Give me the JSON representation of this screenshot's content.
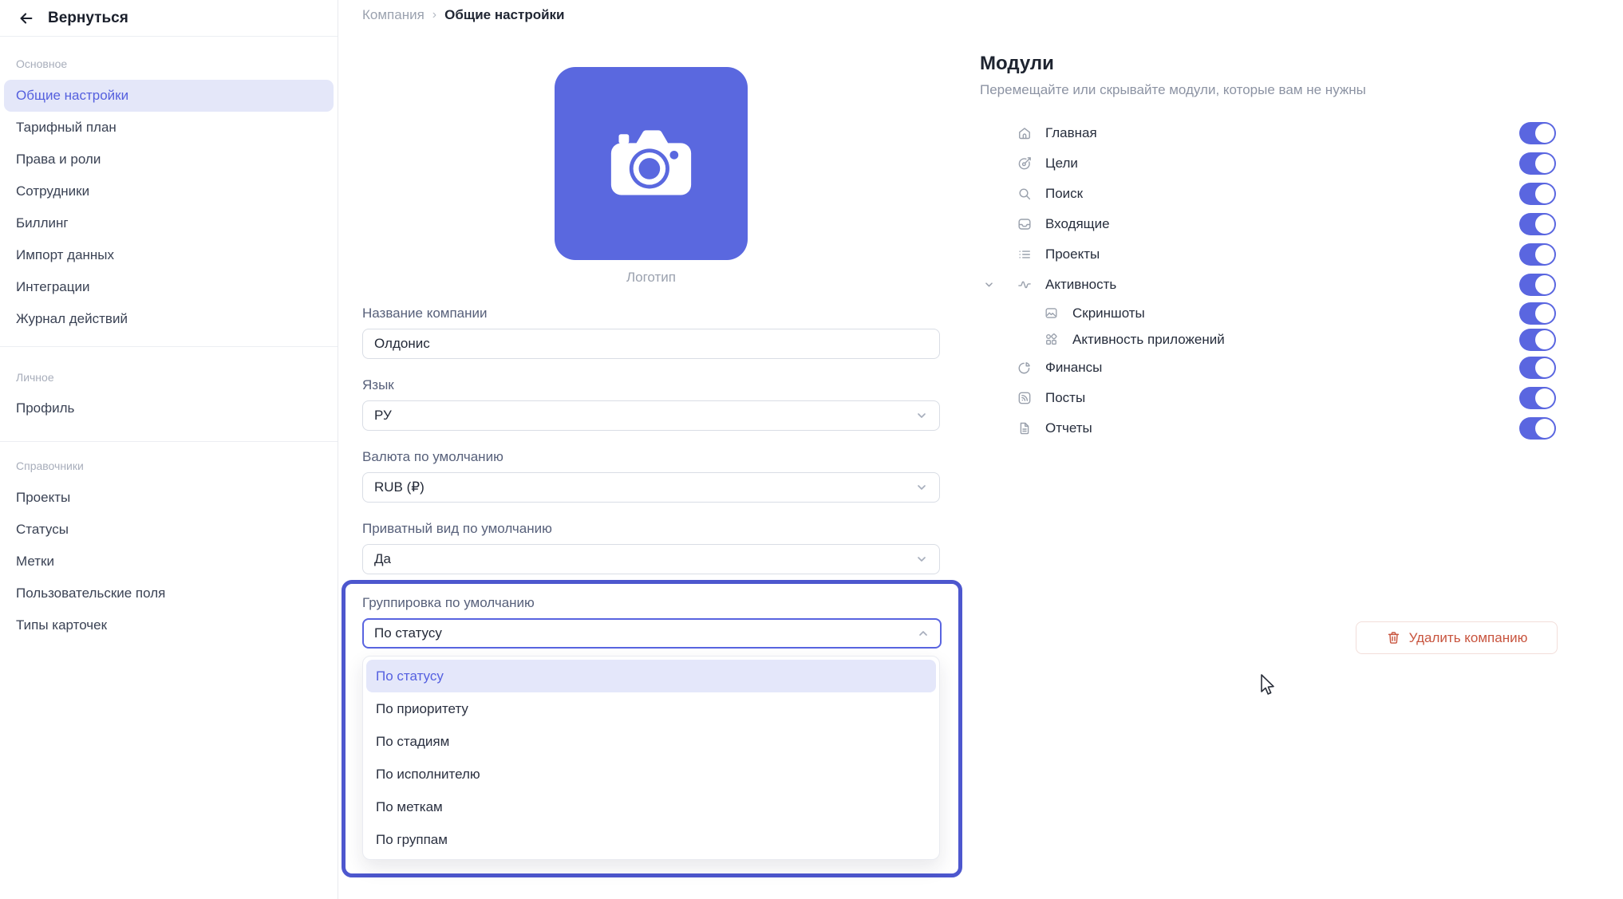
{
  "sidebar": {
    "back_label": "Вернуться",
    "sections": [
      {
        "label": "Основное",
        "items": [
          "Общие настройки",
          "Тарифный план",
          "Права и роли",
          "Сотрудники",
          "Биллинг",
          "Импорт данных",
          "Интеграции",
          "Журнал действий"
        ]
      },
      {
        "label": "Личное",
        "items": [
          "Профиль"
        ]
      },
      {
        "label": "Справочники",
        "items": [
          "Проекты",
          "Статусы",
          "Метки",
          "Пользовательские поля",
          "Типы карточек"
        ]
      }
    ],
    "selected_item": "Общие настройки"
  },
  "breadcrumb": {
    "parent": "Компания",
    "separator": "›",
    "current": "Общие настройки"
  },
  "logo": {
    "caption": "Логотип",
    "icon": "camera-icon"
  },
  "form": {
    "fields": [
      {
        "label": "Название компании",
        "value": "Олдонис",
        "type": "text-input"
      },
      {
        "label": "Язык",
        "value": "РУ",
        "type": "select"
      },
      {
        "label": "Валюта по умолчанию",
        "value": "RUB (₽)",
        "type": "select"
      },
      {
        "label": "Приватный вид по умолчанию",
        "value": "Да",
        "type": "select"
      }
    ],
    "grouping": {
      "label": "Группировка по умолчанию",
      "value": "По статусу",
      "state": "open",
      "options": [
        "По статусу",
        "По приоритету",
        "По стадиям",
        "По исполнителю",
        "По меткам",
        "По группам"
      ],
      "selected_option": "По статусу"
    }
  },
  "modules": {
    "title": "Модули",
    "subtitle": "Перемещайте или скрывайте модули, которые вам не нужны",
    "items": [
      {
        "label": "Главная",
        "icon": "home-icon",
        "enabled": true
      },
      {
        "label": "Цели",
        "icon": "target-icon",
        "enabled": true
      },
      {
        "label": "Поиск",
        "icon": "search-icon",
        "enabled": true
      },
      {
        "label": "Входящие",
        "icon": "inbox-icon",
        "enabled": true
      },
      {
        "label": "Проекты",
        "icon": "list-icon",
        "enabled": true
      },
      {
        "label": "Активность",
        "icon": "activity-icon",
        "enabled": true,
        "expanded": true
      },
      {
        "label": "Скриншоты",
        "icon": "screenshot-icon",
        "enabled": true,
        "child_of": "Активность"
      },
      {
        "label": "Активность приложений",
        "icon": "apps-icon",
        "enabled": true,
        "child_of": "Активность"
      },
      {
        "label": "Финансы",
        "icon": "pie-chart-icon",
        "enabled": true
      },
      {
        "label": "Посты",
        "icon": "rss-icon",
        "enabled": true
      },
      {
        "label": "Отчеты",
        "icon": "report-icon",
        "enabled": true
      }
    ]
  },
  "actions": {
    "delete_company": "Удалить компанию"
  },
  "colors": {
    "accent": "#5a66e0",
    "accent_logo": "#5a68df",
    "selected_bg": "#e4e7fa",
    "selected_text": "#5560e0",
    "focus_outline": "#4d57ce",
    "danger": "#c8543e",
    "icon_gray": "#99a0ac",
    "text_dark": "#1f2532",
    "text_gray": "#9ba2af"
  }
}
